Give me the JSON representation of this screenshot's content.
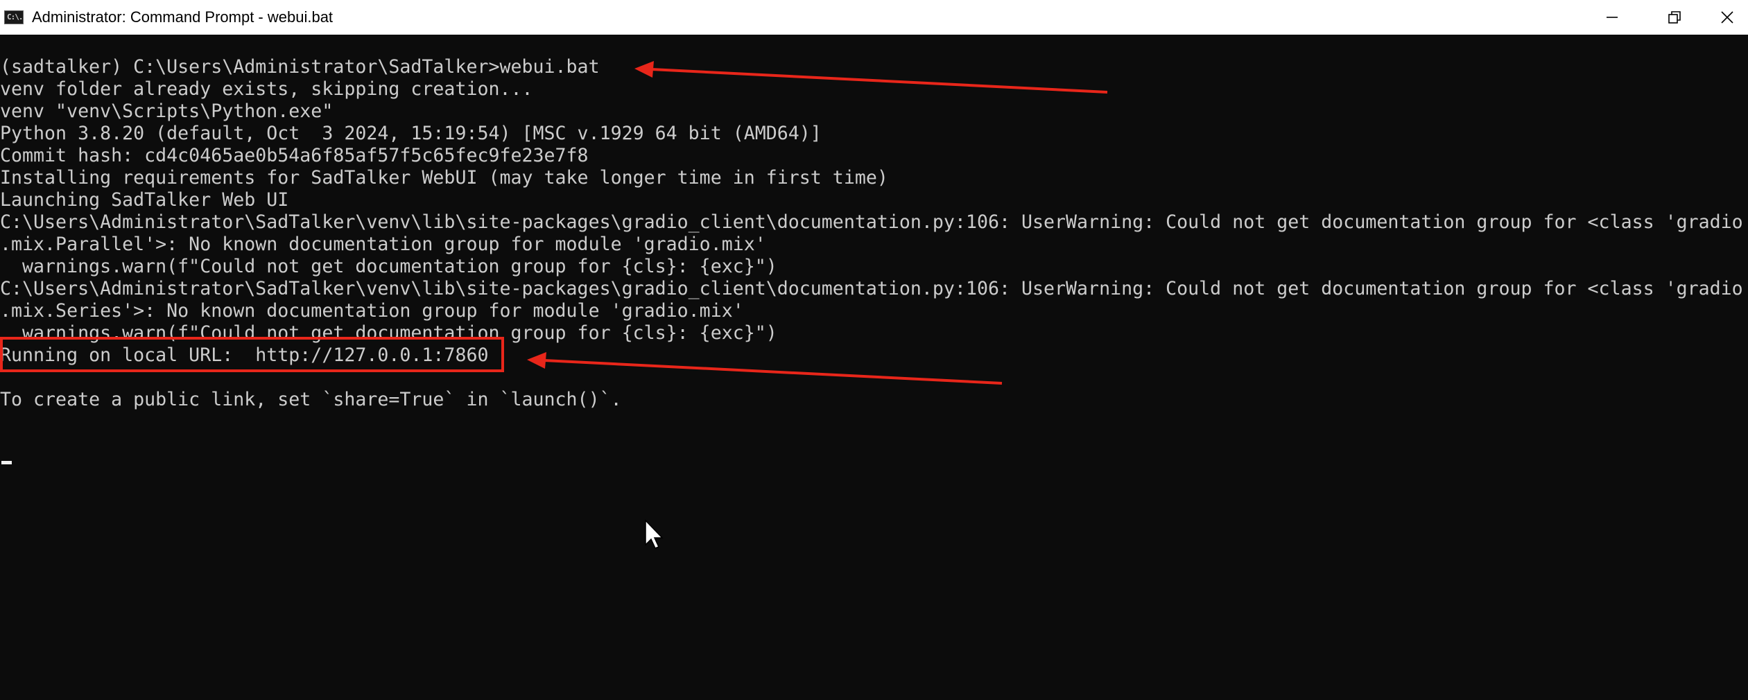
{
  "window": {
    "app_icon": "command-prompt-icon",
    "app_icon_text": "C:\\.",
    "title": "Administrator: Command Prompt - webui.bat",
    "controls": [
      "minimize-icon",
      "restore-icon",
      "close-icon"
    ]
  },
  "terminal": {
    "lines": [
      "(sadtalker) C:\\Users\\Administrator\\SadTalker>webui.bat",
      "venv folder already exists, skipping creation...",
      "venv \"venv\\Scripts\\Python.exe\"",
      "Python 3.8.20 (default, Oct  3 2024, 15:19:54) [MSC v.1929 64 bit (AMD64)]",
      "Commit hash: cd4c0465ae0b54a6f85af57f5c65fec9fe23e7f8",
      "Installing requirements for SadTalker WebUI (may take longer time in first time)",
      "Launching SadTalker Web UI",
      "C:\\Users\\Administrator\\SadTalker\\venv\\lib\\site-packages\\gradio_client\\documentation.py:106: UserWarning: Could not get documentation group for <class 'gradio",
      ".mix.Parallel'>: No known documentation group for module 'gradio.mix'",
      "  warnings.warn(f\"Could not get documentation group for {cls}: {exc}\")",
      "C:\\Users\\Administrator\\SadTalker\\venv\\lib\\site-packages\\gradio_client\\documentation.py:106: UserWarning: Could not get documentation group for <class 'gradio",
      ".mix.Series'>: No known documentation group for module 'gradio.mix'",
      "  warnings.warn(f\"Could not get documentation group for {cls}: {exc}\")",
      "Running on local URL:  http://127.0.0.1:7860",
      "",
      "To create a public link, set `share=True` in `launch()`."
    ]
  },
  "annotations": {
    "color": "#e8261a",
    "arrows": [
      "arrow-to-command",
      "arrow-to-url"
    ],
    "highlight": "local-url-highlight-box"
  },
  "pointer": "mouse-pointer-icon"
}
